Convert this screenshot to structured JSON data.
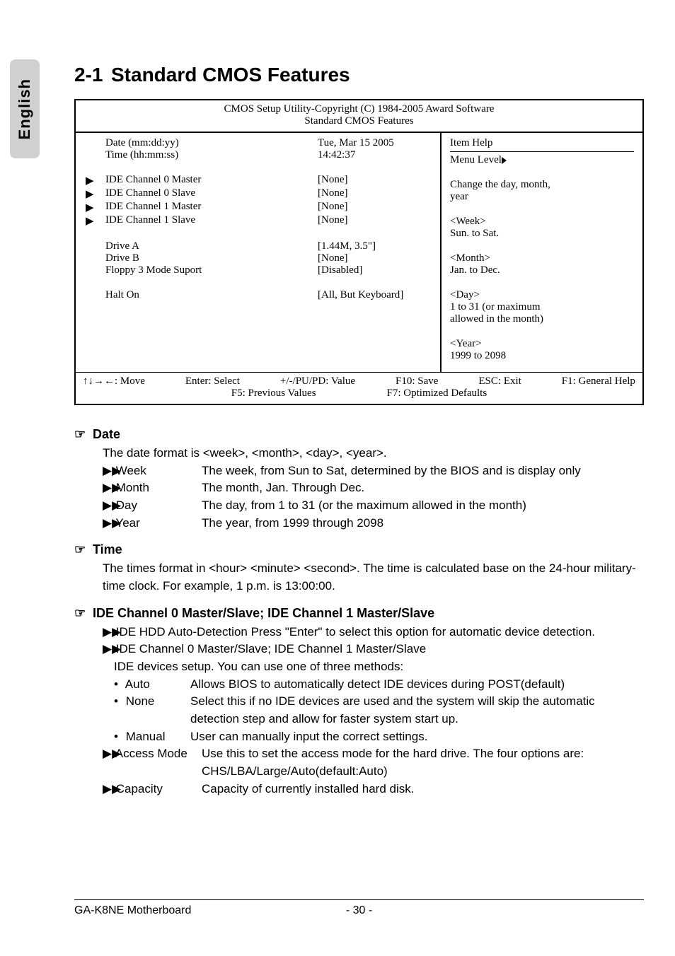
{
  "lang_tab": "English",
  "section_number": "2-1",
  "section_title": "Standard CMOS Features",
  "bios": {
    "header1": "CMOS Setup Utility-Copyright (C) 1984-2005 Award Software",
    "header2": "Standard CMOS Features",
    "date_label": "Date (mm:dd:yy)",
    "date_value": "Tue, Mar  15  2005",
    "time_label": "Time (hh:mm:ss)",
    "time_value": "14:42:37",
    "ide0m_label": "IDE Channel 0 Master",
    "ide0m_val": "[None]",
    "ide0s_label": "IDE Channel 0 Slave",
    "ide0s_val": "[None]",
    "ide1m_label": "IDE Channel 1 Master",
    "ide1m_val": "[None]",
    "ide1s_label": "IDE Channel 1 Slave",
    "ide1s_val": "[None]",
    "driveA_label": "Drive A",
    "driveA_val": "[1.44M, 3.5\"]",
    "driveB_label": "Drive B",
    "driveB_val": "[None]",
    "floppy_label": "Floppy 3 Mode Suport",
    "floppy_val": "[Disabled]",
    "halt_label": "Halt On",
    "halt_val": "[All, But Keyboard]",
    "help_title": "Item Help",
    "menu_level": "Menu Level",
    "help_l1": "Change the day, month,",
    "help_l2": "year",
    "help_l3": "<Week>",
    "help_l4": "Sun. to Sat.",
    "help_l5": "<Month>",
    "help_l6": "Jan. to Dec.",
    "help_l7": "<Day>",
    "help_l8": "1 to 31 (or maximum",
    "help_l9": "allowed in the month)",
    "help_l10": "<Year>",
    "help_l11": "1999 to 2098",
    "foot_move": "↑↓→←: Move",
    "foot_enter": "Enter: Select",
    "foot_pupd": "+/-/PU/PD: Value",
    "foot_f10": "F10: Save",
    "foot_esc": "ESC: Exit",
    "foot_f1": "F1: General Help",
    "foot_f5": "F5: Previous Values",
    "foot_f7": "F7: Optimized Defaults"
  },
  "desc": {
    "date_h": "Date",
    "date_intro": "The date format is <week>, <month>, <day>, <year>.",
    "week_k": "Week",
    "week_v": "The week, from Sun to Sat, determined by the BIOS and is display only",
    "month_k": "Month",
    "month_v": "The month, Jan. Through Dec.",
    "day_k": "Day",
    "day_v": "The day, from 1 to 31 (or the maximum allowed in the month)",
    "year_k": "Year",
    "year_v": "The year, from 1999 through 2098",
    "time_h": "Time",
    "time_txt": "The times format in <hour> <minute> <second>. The time is calculated base on the 24-hour military-time clock. For example, 1 p.m. is 13:00:00.",
    "ide_h": "IDE Channel 0 Master/Slave; IDE Channel 1 Master/Slave",
    "ide_auto": "IDE HDD Auto-Detection Press \"Enter\" to select this option for automatic device detection.",
    "ide_sub": "IDE Channel 0 Master/Slave; IDE Channel 1 Master/Slave",
    "ide_setup": "IDE devices setup. You can use one of three methods:",
    "m_auto_k": "Auto",
    "m_auto_v": "Allows BIOS to automatically detect IDE devices during POST(default)",
    "m_none_k": "None",
    "m_none_v1": "Select this if no IDE devices are used and the system will skip the automatic",
    "m_none_v2": "detection step and allow for faster system start up.",
    "m_manual_k": "Manual",
    "m_manual_v": "User can manually input the correct settings.",
    "access_k": "Access Mode",
    "access_v1": "Use this to set the access mode for the hard drive. The four options are:",
    "access_v2": "CHS/LBA/Large/Auto(default:Auto)",
    "capacity_k": "Capacity",
    "capacity_v": "Capacity of currently installed hard disk."
  },
  "footer": {
    "left": "GA-K8NE Motherboard",
    "center": "- 30 -"
  }
}
